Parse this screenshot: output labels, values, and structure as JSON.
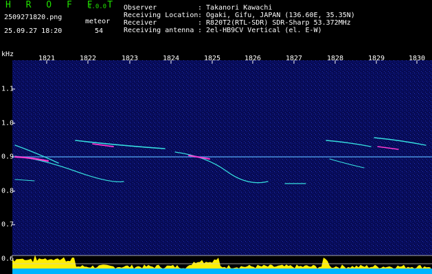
{
  "header": {
    "brand": "H R O F F T",
    "version": "1.0.0",
    "filename": "2509271820.png",
    "datetime": "25.09.27 18:20",
    "meteor_label": "meteor",
    "meteor_count": "54"
  },
  "info": [
    {
      "label": "Observer",
      "value": ": Takanori Kawachi"
    },
    {
      "label": "Receiving Location",
      "value": ": Ogaki, Gifu, JAPAN (136.60E, 35.35N)"
    },
    {
      "label": "Receiver",
      "value": ": R820T2(RTL-SDR) SDR-Sharp 53.372MHz"
    },
    {
      "label": "Receiving antenna",
      "value": ": 2el-HB9CV Vertical (el. E-W)"
    }
  ],
  "axis": {
    "unit": "kHz",
    "x_ticks": [
      "1821",
      "1822",
      "1823",
      "1824",
      "1825",
      "1826",
      "1827",
      "1828",
      "1829",
      "1830"
    ],
    "y_ticks": [
      "1.1",
      "1.0",
      "0.9",
      "0.8",
      "0.7",
      "0.6"
    ]
  },
  "colors": {
    "background": "#000000",
    "spectrum": "#0a0f6e",
    "carrier": "#5ab4ff",
    "trace": "#36e0e0",
    "hot": "#ff3ad0",
    "level_fill": "#ffee00",
    "level_base": "#00b4ff",
    "brand": "#21e000"
  }
}
